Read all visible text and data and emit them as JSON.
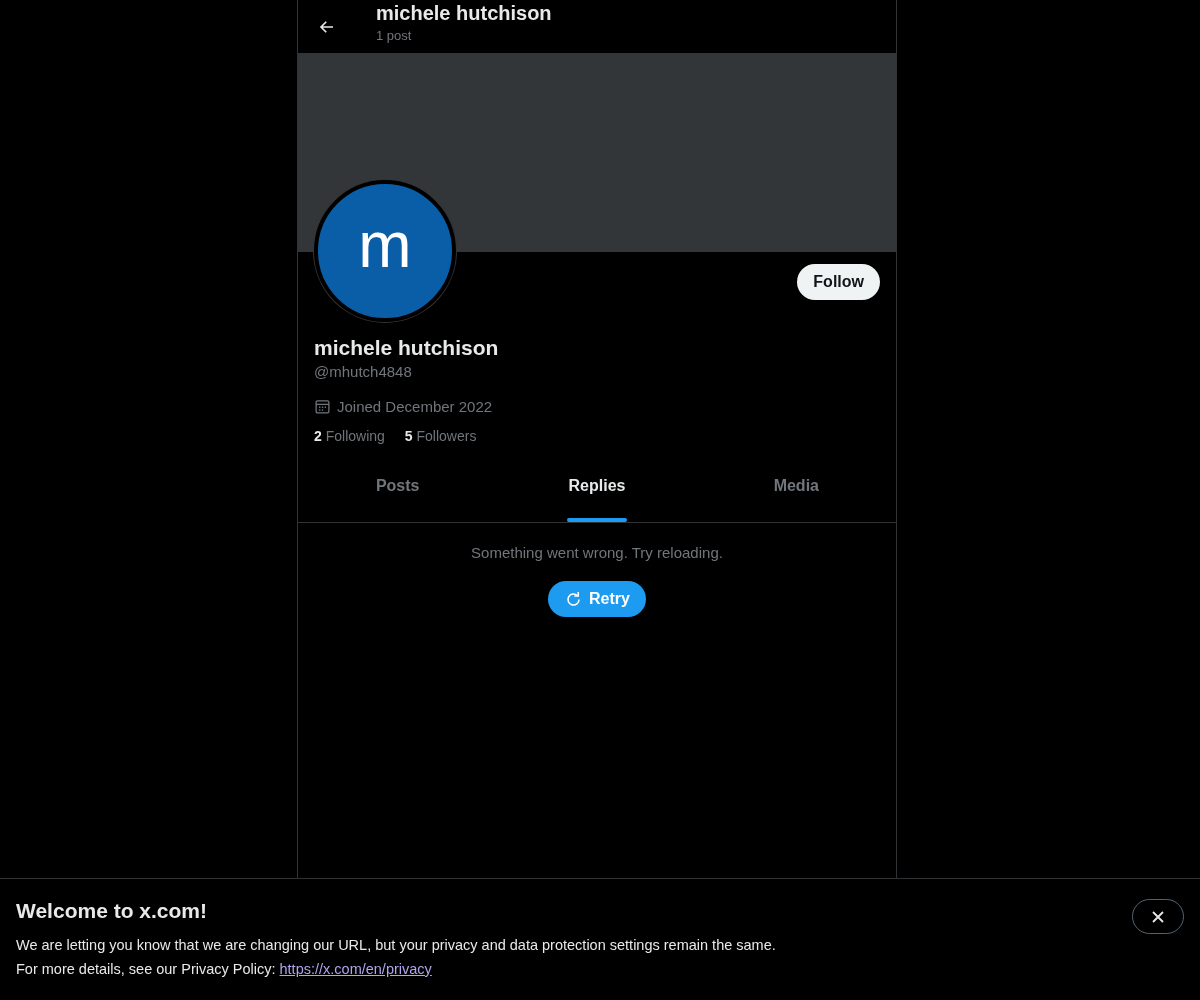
{
  "header": {
    "title": "michele hutchison",
    "subtitle": "1 post"
  },
  "profile": {
    "avatar_letter": "m",
    "follow_button": "Follow",
    "name": "michele hutchison",
    "handle": "@mhutch4848",
    "joined": "Joined December 2022",
    "stats": [
      {
        "count": "2",
        "label": "Following"
      },
      {
        "count": "5",
        "label": "Followers"
      }
    ]
  },
  "tabs": [
    {
      "label": "Posts",
      "selected": false
    },
    {
      "label": "Replies",
      "selected": true
    },
    {
      "label": "Media",
      "selected": false
    }
  ],
  "error": {
    "message": "Something went wrong. Try reloading.",
    "button": "Retry"
  },
  "notice": {
    "title": "Welcome to x.com!",
    "text": "We are letting you know that we are changing our URL, but your privacy and data protection settings remain the same.",
    "details": "For more details, see our Privacy Policy:",
    "link": "https://x.com/en/privacy"
  }
}
